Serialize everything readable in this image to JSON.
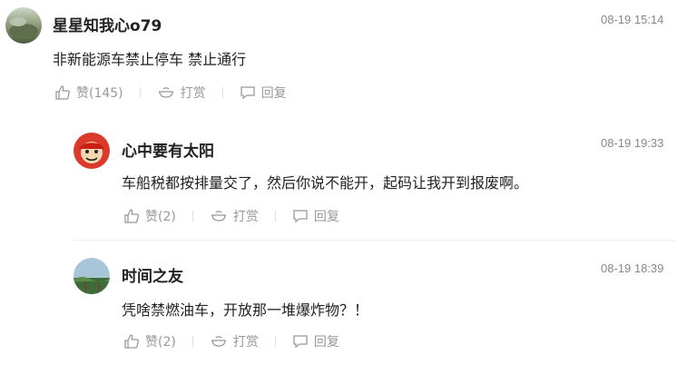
{
  "comments": [
    {
      "username": "星星知我心o79",
      "time": "08-19 15:14",
      "text": "非新能源车禁止停车 禁止通行",
      "like_label": "赞(145)",
      "tip_label": "打赏",
      "reply_label": "回复"
    },
    {
      "username": "心中要有太阳",
      "time": "08-19 19:33",
      "text": "车船税都按排量交了，然后你说不能开，起码让我开到报废啊。",
      "like_label": "赞(2)",
      "tip_label": "打赏",
      "reply_label": "回复"
    },
    {
      "username": "时间之友",
      "time": "08-19 18:39",
      "text": "凭啥禁燃油车，开放那一堆爆炸物？！",
      "like_label": "赞(2)",
      "tip_label": "打赏",
      "reply_label": "回复"
    }
  ],
  "icons": {
    "like": "thumbs-up-icon",
    "tip": "tip-bowl-icon",
    "reply": "reply-bubble-icon"
  },
  "colors": {
    "text": "#222222",
    "muted": "#999999",
    "divider": "#eeeeee"
  }
}
